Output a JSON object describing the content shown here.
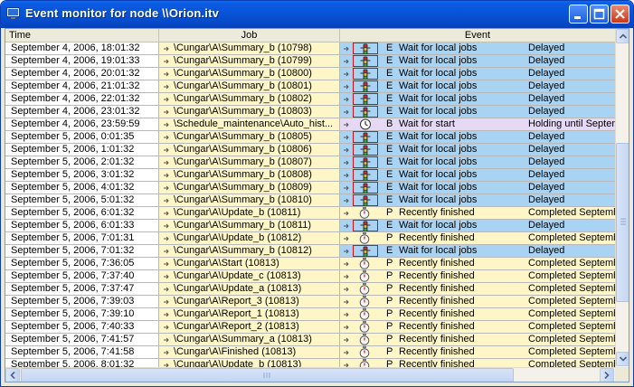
{
  "window": {
    "title": "Event monitor for node \\\\Orion.itv"
  },
  "columns": {
    "time": "Time",
    "job": "Job",
    "event": "Event"
  },
  "colors": {
    "blue_event": "#a9d3f2",
    "pink_event": "#e6d9f5",
    "yellow_event": "#fff6c7",
    "title_bar": "#0853d6"
  },
  "rows": [
    {
      "time": "September 4, 2006, 18:01:32",
      "job": "\\Cungar\\A\\Summary_b (10798)",
      "status_icon": "traffic-light-icon",
      "code": "E",
      "message": "Wait for local jobs",
      "detail": "Delayed",
      "style": "blue"
    },
    {
      "time": "September 4, 2006, 19:01:33",
      "job": "\\Cungar\\A\\Summary_b (10799)",
      "status_icon": "traffic-light-icon",
      "code": "E",
      "message": "Wait for local jobs",
      "detail": "Delayed",
      "style": "blue"
    },
    {
      "time": "September 4, 2006, 20:01:32",
      "job": "\\Cungar\\A\\Summary_b (10800)",
      "status_icon": "traffic-light-icon",
      "code": "E",
      "message": "Wait for local jobs",
      "detail": "Delayed",
      "style": "blue"
    },
    {
      "time": "September 4, 2006, 21:01:32",
      "job": "\\Cungar\\A\\Summary_b (10801)",
      "status_icon": "traffic-light-icon",
      "code": "E",
      "message": "Wait for local jobs",
      "detail": "Delayed",
      "style": "blue"
    },
    {
      "time": "September 4, 2006, 22:01:32",
      "job": "\\Cungar\\A\\Summary_b (10802)",
      "status_icon": "traffic-light-icon",
      "code": "E",
      "message": "Wait for local jobs",
      "detail": "Delayed",
      "style": "blue"
    },
    {
      "time": "September 4, 2006, 23:01:32",
      "job": "\\Cungar\\A\\Summary_b (10803)",
      "status_icon": "traffic-light-icon",
      "code": "E",
      "message": "Wait for local jobs",
      "detail": "Delayed",
      "style": "blue"
    },
    {
      "time": "September 4, 2006, 23:59:59",
      "job": "\\Schedule_maintenance\\Auto_hist...",
      "status_icon": "clock-icon",
      "code": "B",
      "message": "Wait for start",
      "detail": "Holding until Septem",
      "style": "pink"
    },
    {
      "time": "September 5, 2006,  0:01:35",
      "job": "\\Cungar\\A\\Summary_b (10805)",
      "status_icon": "traffic-light-icon",
      "code": "E",
      "message": "Wait for local jobs",
      "detail": "Delayed",
      "style": "blue"
    },
    {
      "time": "September 5, 2006,  1:01:32",
      "job": "\\Cungar\\A\\Summary_b (10806)",
      "status_icon": "traffic-light-icon",
      "code": "E",
      "message": "Wait for local jobs",
      "detail": "Delayed",
      "style": "blue"
    },
    {
      "time": "September 5, 2006,  2:01:32",
      "job": "\\Cungar\\A\\Summary_b (10807)",
      "status_icon": "traffic-light-icon",
      "code": "E",
      "message": "Wait for local jobs",
      "detail": "Delayed",
      "style": "blue"
    },
    {
      "time": "September 5, 2006,  3:01:32",
      "job": "\\Cungar\\A\\Summary_b (10808)",
      "status_icon": "traffic-light-icon",
      "code": "E",
      "message": "Wait for local jobs",
      "detail": "Delayed",
      "style": "blue"
    },
    {
      "time": "September 5, 2006,  4:01:32",
      "job": "\\Cungar\\A\\Summary_b (10809)",
      "status_icon": "traffic-light-icon",
      "code": "E",
      "message": "Wait for local jobs",
      "detail": "Delayed",
      "style": "blue"
    },
    {
      "time": "September 5, 2006,  5:01:32",
      "job": "\\Cungar\\A\\Summary_b (10810)",
      "status_icon": "traffic-light-icon",
      "code": "E",
      "message": "Wait for local jobs",
      "detail": "Delayed",
      "style": "blue"
    },
    {
      "time": "September 5, 2006,  6:01:32",
      "job": "\\Cungar\\A\\Update_b (10811)",
      "status_icon": "stopwatch-icon",
      "code": "P",
      "message": "Recently finished",
      "detail": "Completed Septemb",
      "style": "yellow"
    },
    {
      "time": "September 5, 2006,  6:01:33",
      "job": "\\Cungar\\A\\Summary_b (10811)",
      "status_icon": "traffic-light-icon",
      "code": "E",
      "message": "Wait for local jobs",
      "detail": "Delayed",
      "style": "blue"
    },
    {
      "time": "September 5, 2006,  7:01:31",
      "job": "\\Cungar\\A\\Update_b (10812)",
      "status_icon": "stopwatch-icon",
      "code": "P",
      "message": "Recently finished",
      "detail": "Completed Septemb",
      "style": "yellow"
    },
    {
      "time": "September 5, 2006,  7:01:32",
      "job": "\\Cungar\\A\\Summary_b (10812)",
      "status_icon": "traffic-light-icon",
      "code": "E",
      "message": "Wait for local jobs",
      "detail": "Delayed",
      "style": "blue"
    },
    {
      "time": "September 5, 2006,  7:36:05",
      "job": "\\Cungar\\A\\Start (10813)",
      "status_icon": "stopwatch-icon",
      "code": "P",
      "message": "Recently finished",
      "detail": "Completed Septemb",
      "style": "yellow"
    },
    {
      "time": "September 5, 2006,  7:37:40",
      "job": "\\Cungar\\A\\Update_c (10813)",
      "status_icon": "stopwatch-icon",
      "code": "P",
      "message": "Recently finished",
      "detail": "Completed Septemb",
      "style": "yellow"
    },
    {
      "time": "September 5, 2006,  7:37:47",
      "job": "\\Cungar\\A\\Update_a (10813)",
      "status_icon": "stopwatch-icon",
      "code": "P",
      "message": "Recently finished",
      "detail": "Completed Septemb",
      "style": "yellow"
    },
    {
      "time": "September 5, 2006,  7:39:03",
      "job": "\\Cungar\\A\\Report_3 (10813)",
      "status_icon": "stopwatch-icon",
      "code": "P",
      "message": "Recently finished",
      "detail": "Completed Septemb",
      "style": "yellow"
    },
    {
      "time": "September 5, 2006,  7:39:10",
      "job": "\\Cungar\\A\\Report_1 (10813)",
      "status_icon": "stopwatch-icon",
      "code": "P",
      "message": "Recently finished",
      "detail": "Completed Septemb",
      "style": "yellow"
    },
    {
      "time": "September 5, 2006,  7:40:33",
      "job": "\\Cungar\\A\\Report_2 (10813)",
      "status_icon": "stopwatch-icon",
      "code": "P",
      "message": "Recently finished",
      "detail": "Completed Septemb",
      "style": "yellow"
    },
    {
      "time": "September 5, 2006,  7:41:57",
      "job": "\\Cungar\\A\\Summary_a (10813)",
      "status_icon": "stopwatch-icon",
      "code": "P",
      "message": "Recently finished",
      "detail": "Completed Septemb",
      "style": "yellow"
    },
    {
      "time": "September 5, 2006,  7:41:58",
      "job": "\\Cungar\\A\\Finished (10813)",
      "status_icon": "stopwatch-icon",
      "code": "P",
      "message": "Recently finished",
      "detail": "Completed Septemb",
      "style": "yellow"
    },
    {
      "time": "September 5, 2006,  8:01:32",
      "job": "\\Cungar\\A\\Update_b (10813)",
      "status_icon": "stopwatch-icon",
      "code": "P",
      "message": "Recently finished",
      "detail": "Completed Septemb",
      "style": "yellow"
    }
  ]
}
